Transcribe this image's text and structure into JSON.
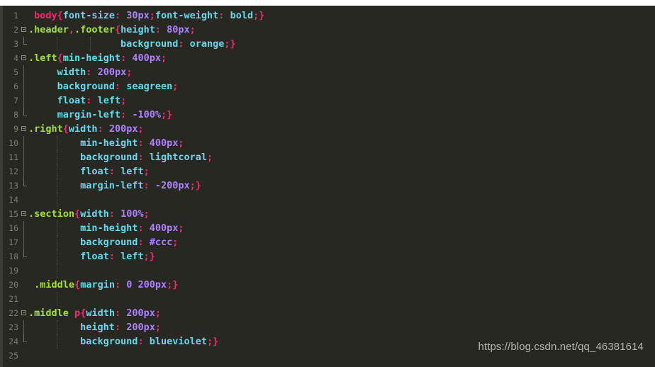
{
  "editor": {
    "name": "code-editor",
    "language": "css",
    "theme": "monokai-dark",
    "colors": {
      "background": "#272822",
      "gutter_text": "#7b7e6e",
      "element_selector": "#f92672",
      "class_selector": "#a6e22e",
      "punctuation": "#f92672",
      "property": "#66d9ef",
      "value_keyword": "#66d9ef",
      "number": "#ae81ff",
      "indent_guide": "#55584a",
      "watermark": "#c9c9c3"
    },
    "total_lines": 25
  },
  "watermark": {
    "text": "https://blog.csdn.net/qq_46381614"
  },
  "lines": [
    {
      "number": "1",
      "fold": "none",
      "indent_guides": [],
      "tokens": [
        {
          "text": " ",
          "type": "plain"
        },
        {
          "text": "body",
          "type": "element"
        },
        {
          "text": "{",
          "type": "punct"
        },
        {
          "text": "font-size",
          "type": "prop"
        },
        {
          "text": ":",
          "type": "punct"
        },
        {
          "text": " ",
          "type": "plain"
        },
        {
          "text": "30px",
          "type": "num"
        },
        {
          "text": ";",
          "type": "punct"
        },
        {
          "text": "font-weight",
          "type": "prop"
        },
        {
          "text": ":",
          "type": "punct"
        },
        {
          "text": " ",
          "type": "plain"
        },
        {
          "text": "bold",
          "type": "val"
        },
        {
          "text": ";}",
          "type": "punct"
        }
      ]
    },
    {
      "number": "2",
      "fold": "open",
      "indent_guides": [],
      "tokens": [
        {
          "text": ".header",
          "type": "class"
        },
        {
          "text": ",",
          "type": "punct"
        },
        {
          "text": ".footer",
          "type": "class"
        },
        {
          "text": "{",
          "type": "punct"
        },
        {
          "text": "height",
          "type": "prop"
        },
        {
          "text": ":",
          "type": "punct"
        },
        {
          "text": " ",
          "type": "plain"
        },
        {
          "text": "80px",
          "type": "num"
        },
        {
          "text": ";",
          "type": "punct"
        }
      ]
    },
    {
      "number": "3",
      "fold": "end",
      "indent_guides": [
        80,
        127
      ],
      "tokens": [
        {
          "text": "                ",
          "type": "plain"
        },
        {
          "text": "background",
          "type": "prop"
        },
        {
          "text": ":",
          "type": "punct"
        },
        {
          "text": " ",
          "type": "plain"
        },
        {
          "text": "orange",
          "type": "val"
        },
        {
          "text": ";}",
          "type": "punct"
        }
      ]
    },
    {
      "number": "4",
      "fold": "open",
      "indent_guides": [],
      "tokens": [
        {
          "text": ".left",
          "type": "class"
        },
        {
          "text": "{",
          "type": "punct"
        },
        {
          "text": "min-height",
          "type": "prop"
        },
        {
          "text": ":",
          "type": "punct"
        },
        {
          "text": " ",
          "type": "plain"
        },
        {
          "text": "400px",
          "type": "num"
        },
        {
          "text": ";",
          "type": "punct"
        }
      ]
    },
    {
      "number": "5",
      "fold": "bar",
      "indent_guides": [],
      "tokens": [
        {
          "text": "     ",
          "type": "plain"
        },
        {
          "text": "width",
          "type": "prop"
        },
        {
          "text": ":",
          "type": "punct"
        },
        {
          "text": " ",
          "type": "plain"
        },
        {
          "text": "200px",
          "type": "num"
        },
        {
          "text": ";",
          "type": "punct"
        }
      ]
    },
    {
      "number": "6",
      "fold": "bar",
      "indent_guides": [],
      "tokens": [
        {
          "text": "     ",
          "type": "plain"
        },
        {
          "text": "background",
          "type": "prop"
        },
        {
          "text": ":",
          "type": "punct"
        },
        {
          "text": " ",
          "type": "plain"
        },
        {
          "text": "seagreen",
          "type": "val"
        },
        {
          "text": ";",
          "type": "punct"
        }
      ]
    },
    {
      "number": "7",
      "fold": "bar",
      "indent_guides": [],
      "tokens": [
        {
          "text": "     ",
          "type": "plain"
        },
        {
          "text": "float",
          "type": "prop"
        },
        {
          "text": ":",
          "type": "punct"
        },
        {
          "text": " ",
          "type": "plain"
        },
        {
          "text": "left",
          "type": "val"
        },
        {
          "text": ";",
          "type": "punct"
        }
      ]
    },
    {
      "number": "8",
      "fold": "end",
      "indent_guides": [],
      "tokens": [
        {
          "text": "     ",
          "type": "plain"
        },
        {
          "text": "margin-left",
          "type": "prop"
        },
        {
          "text": ":",
          "type": "punct"
        },
        {
          "text": " ",
          "type": "plain"
        },
        {
          "text": "-100%",
          "type": "num"
        },
        {
          "text": ";}",
          "type": "punct"
        }
      ]
    },
    {
      "number": "9",
      "fold": "open",
      "indent_guides": [],
      "tokens": [
        {
          "text": ".right",
          "type": "class"
        },
        {
          "text": "{",
          "type": "punct"
        },
        {
          "text": "width",
          "type": "prop"
        },
        {
          "text": ":",
          "type": "punct"
        },
        {
          "text": " ",
          "type": "plain"
        },
        {
          "text": "200px",
          "type": "num"
        },
        {
          "text": ";",
          "type": "punct"
        }
      ]
    },
    {
      "number": "10",
      "fold": "bar",
      "indent_guides": [
        80
      ],
      "tokens": [
        {
          "text": "         ",
          "type": "plain"
        },
        {
          "text": "min-height",
          "type": "prop"
        },
        {
          "text": ":",
          "type": "punct"
        },
        {
          "text": " ",
          "type": "plain"
        },
        {
          "text": "400px",
          "type": "num"
        },
        {
          "text": ";",
          "type": "punct"
        }
      ]
    },
    {
      "number": "11",
      "fold": "bar",
      "indent_guides": [
        80
      ],
      "tokens": [
        {
          "text": "         ",
          "type": "plain"
        },
        {
          "text": "background",
          "type": "prop"
        },
        {
          "text": ":",
          "type": "punct"
        },
        {
          "text": " ",
          "type": "plain"
        },
        {
          "text": "lightcoral",
          "type": "val"
        },
        {
          "text": ";",
          "type": "punct"
        }
      ]
    },
    {
      "number": "12",
      "fold": "bar",
      "indent_guides": [
        80
      ],
      "tokens": [
        {
          "text": "         ",
          "type": "plain"
        },
        {
          "text": "float",
          "type": "prop"
        },
        {
          "text": ":",
          "type": "punct"
        },
        {
          "text": " ",
          "type": "plain"
        },
        {
          "text": "left",
          "type": "val"
        },
        {
          "text": ";",
          "type": "punct"
        }
      ]
    },
    {
      "number": "13",
      "fold": "end",
      "indent_guides": [
        80
      ],
      "tokens": [
        {
          "text": "         ",
          "type": "plain"
        },
        {
          "text": "margin-left",
          "type": "prop"
        },
        {
          "text": ":",
          "type": "punct"
        },
        {
          "text": " ",
          "type": "plain"
        },
        {
          "text": "-200px",
          "type": "num"
        },
        {
          "text": ";}",
          "type": "punct"
        }
      ]
    },
    {
      "number": "14",
      "fold": "none",
      "indent_guides": [
        80
      ],
      "tokens": []
    },
    {
      "number": "15",
      "fold": "open",
      "indent_guides": [],
      "tokens": [
        {
          "text": ".section",
          "type": "class"
        },
        {
          "text": "{",
          "type": "punct"
        },
        {
          "text": "width",
          "type": "prop"
        },
        {
          "text": ":",
          "type": "punct"
        },
        {
          "text": " ",
          "type": "plain"
        },
        {
          "text": "100%",
          "type": "num"
        },
        {
          "text": ";",
          "type": "punct"
        }
      ]
    },
    {
      "number": "16",
      "fold": "bar",
      "indent_guides": [
        80
      ],
      "tokens": [
        {
          "text": "         ",
          "type": "plain"
        },
        {
          "text": "min-height",
          "type": "prop"
        },
        {
          "text": ":",
          "type": "punct"
        },
        {
          "text": " ",
          "type": "plain"
        },
        {
          "text": "400px",
          "type": "num"
        },
        {
          "text": ";",
          "type": "punct"
        }
      ]
    },
    {
      "number": "17",
      "fold": "bar",
      "indent_guides": [
        80
      ],
      "tokens": [
        {
          "text": "         ",
          "type": "plain"
        },
        {
          "text": "background",
          "type": "prop"
        },
        {
          "text": ":",
          "type": "punct"
        },
        {
          "text": " ",
          "type": "plain"
        },
        {
          "text": "#ccc",
          "type": "num"
        },
        {
          "text": ";",
          "type": "punct"
        }
      ]
    },
    {
      "number": "18",
      "fold": "end",
      "indent_guides": [
        80
      ],
      "tokens": [
        {
          "text": "         ",
          "type": "plain"
        },
        {
          "text": "float",
          "type": "prop"
        },
        {
          "text": ":",
          "type": "punct"
        },
        {
          "text": " ",
          "type": "plain"
        },
        {
          "text": "left",
          "type": "val"
        },
        {
          "text": ";}",
          "type": "punct"
        }
      ]
    },
    {
      "number": "19",
      "fold": "none",
      "indent_guides": [
        80
      ],
      "tokens": []
    },
    {
      "number": "20",
      "fold": "none",
      "indent_guides": [],
      "tokens": [
        {
          "text": " ",
          "type": "plain"
        },
        {
          "text": ".middle",
          "type": "class"
        },
        {
          "text": "{",
          "type": "punct"
        },
        {
          "text": "margin",
          "type": "prop"
        },
        {
          "text": ":",
          "type": "punct"
        },
        {
          "text": " ",
          "type": "plain"
        },
        {
          "text": "0",
          "type": "num"
        },
        {
          "text": " ",
          "type": "plain"
        },
        {
          "text": "200px",
          "type": "num"
        },
        {
          "text": ";}",
          "type": "punct"
        }
      ]
    },
    {
      "number": "21",
      "fold": "none",
      "indent_guides": [
        80
      ],
      "tokens": []
    },
    {
      "number": "22",
      "fold": "open",
      "indent_guides": [],
      "tokens": [
        {
          "text": ".middle",
          "type": "class"
        },
        {
          "text": " ",
          "type": "plain"
        },
        {
          "text": "p",
          "type": "element"
        },
        {
          "text": "{",
          "type": "punct"
        },
        {
          "text": "width",
          "type": "prop"
        },
        {
          "text": ":",
          "type": "punct"
        },
        {
          "text": " ",
          "type": "plain"
        },
        {
          "text": "200px",
          "type": "num"
        },
        {
          "text": ";",
          "type": "punct"
        }
      ]
    },
    {
      "number": "23",
      "fold": "bar",
      "indent_guides": [
        80
      ],
      "tokens": [
        {
          "text": "         ",
          "type": "plain"
        },
        {
          "text": "height",
          "type": "prop"
        },
        {
          "text": ":",
          "type": "punct"
        },
        {
          "text": " ",
          "type": "plain"
        },
        {
          "text": "200px",
          "type": "num"
        },
        {
          "text": ";",
          "type": "punct"
        }
      ]
    },
    {
      "number": "24",
      "fold": "end",
      "indent_guides": [
        80
      ],
      "tokens": [
        {
          "text": "         ",
          "type": "plain"
        },
        {
          "text": "background",
          "type": "prop"
        },
        {
          "text": ":",
          "type": "punct"
        },
        {
          "text": " ",
          "type": "plain"
        },
        {
          "text": "blueviolet",
          "type": "val"
        },
        {
          "text": ";}",
          "type": "punct"
        }
      ]
    },
    {
      "number": "25",
      "fold": "none",
      "indent_guides": [],
      "tokens": []
    }
  ]
}
